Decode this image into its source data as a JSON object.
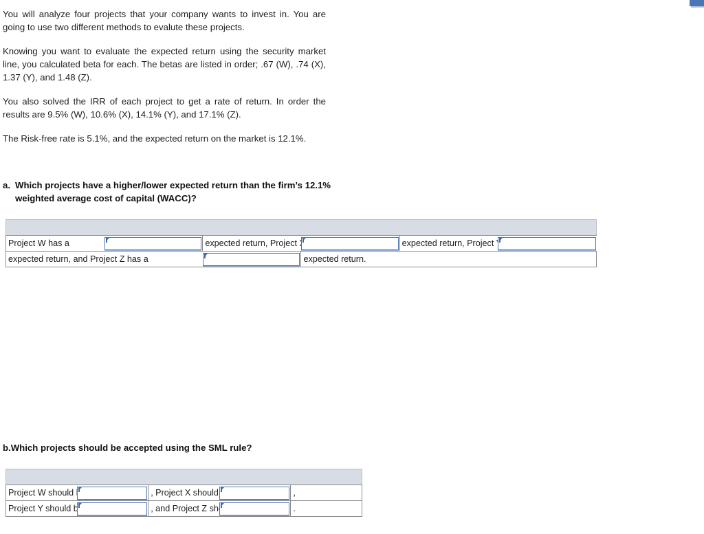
{
  "document": {
    "paragraphs": [
      "You will analyze four projects that your company wants to invest in.  You are going to use two different methods to evalute these projects.",
      "Knowing you want to evaluate the expected return using the security market line, you calculated beta for each.   The betas are listed in order;  .67 (W), .74 (X), 1.37 (Y), and 1.48 (Z).",
      "You also solved the IRR of each project to get a rate of return.  In order the results are 9.5% (W),  10.6% (X), 14.1% (Y), and  17.1% (Z).",
      "The Risk-free rate is 5.1%, and the expected return on the market is 12.1%."
    ],
    "question_a": {
      "letter": "a.",
      "text": "Which projects have a higher/lower expected return than the firm’s 12.1% weighted average cost of capital (WACC)?"
    },
    "question_b": {
      "text": "b.Which projects should be accepted using the SML rule?"
    }
  },
  "answer_table_a": {
    "header_band_label": "",
    "row1": {
      "label1": "Project W has a",
      "field1_value": "",
      "label2": "expected return, Project X has a",
      "field2_value": "",
      "label3": "expected return, Project Y has a",
      "field3_value": ""
    },
    "row2": {
      "label1": "expected return, and Project Z has a",
      "field1_value": "",
      "label2": "expected return."
    }
  },
  "answer_table_b": {
    "header_band_label": "",
    "row1": {
      "label1": "Project W should be",
      "field1_value": "",
      "label2": ", Project X should be",
      "field2_value": "",
      "punct": ","
    },
    "row2": {
      "label1": "Project Y should be",
      "field1_value": "",
      "label2": ", and Project Z should be",
      "field2_value": "",
      "punct": "."
    }
  },
  "colors": {
    "field_border": "#4a74b5",
    "header_band": "#d7dce5",
    "table_border": "#8a8a8a",
    "accent_chip": "#4a77b4",
    "text": "#1b1b1b"
  }
}
